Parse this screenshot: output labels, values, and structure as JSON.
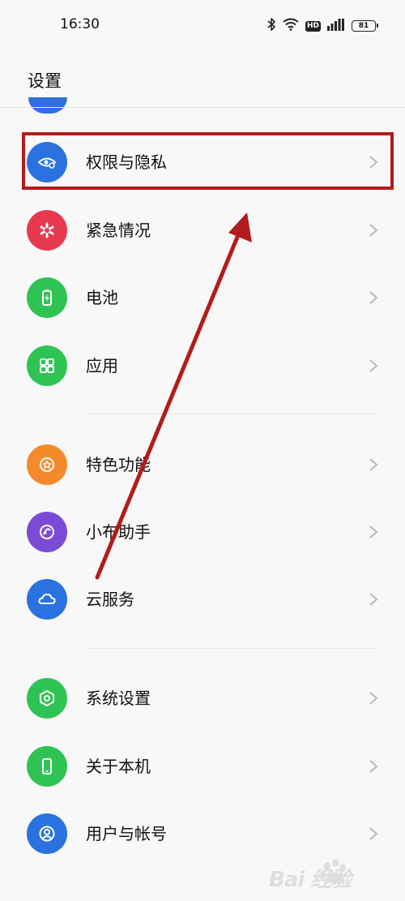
{
  "status_bar": {
    "time": "16:30",
    "hd": "HD",
    "battery": "81",
    "icons": [
      "bluetooth-icon",
      "wifi-icon",
      "signal-icon",
      "battery-icon"
    ]
  },
  "header": {
    "title": "设置"
  },
  "items": [
    {
      "label": "权限与隐私",
      "icon": "privacy-eye-icon",
      "color": "#2a72e0"
    },
    {
      "label": "紧急情况",
      "icon": "emergency-asterisk-icon",
      "color": "#e6394f"
    },
    {
      "label": "电池",
      "icon": "battery-charge-icon",
      "color": "#2fc354"
    },
    {
      "label": "应用",
      "icon": "apps-grid-icon",
      "color": "#2fc354"
    },
    {
      "label": "特色功能",
      "icon": "feature-star-icon",
      "color": "#f58a2c"
    },
    {
      "label": "小布助手",
      "icon": "assistant-icon",
      "color": "#7b4bd6"
    },
    {
      "label": "云服务",
      "icon": "cloud-icon",
      "color": "#2a72e0"
    },
    {
      "label": "系统设置",
      "icon": "system-hexagon-icon",
      "color": "#2fc354"
    },
    {
      "label": "关于本机",
      "icon": "phone-icon",
      "color": "#2fc354"
    },
    {
      "label": "用户与帐号",
      "icon": "user-icon",
      "color": "#2a72e0"
    }
  ],
  "annotation": {
    "highlight_color": "#b21c1c"
  },
  "watermark": {
    "text": "Bai  经验"
  }
}
